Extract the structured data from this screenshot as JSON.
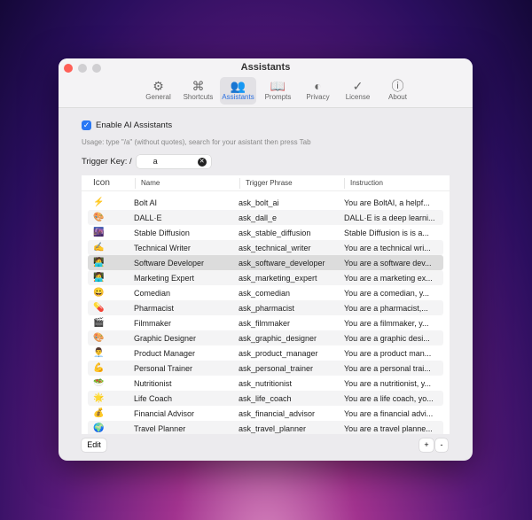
{
  "window": {
    "title": "Assistants"
  },
  "tabs": [
    {
      "label": "General",
      "icon": "⚙"
    },
    {
      "label": "Shortcuts",
      "icon": "⌘"
    },
    {
      "label": "Assistants",
      "icon": "👥"
    },
    {
      "label": "Prompts",
      "icon": "📖"
    },
    {
      "label": "Privacy",
      "icon": "◐"
    },
    {
      "label": "License",
      "icon": "✓"
    },
    {
      "label": "About",
      "icon": "ⓘ"
    }
  ],
  "active_tab": "Assistants",
  "enable_label": "Enable AI Assistants",
  "enable_checked": true,
  "usage": "Usage: type \"/a\" (without quotes), search for your asistant then press Tab",
  "trigger_label": "Trigger Key: /",
  "trigger_value": "a",
  "columns": [
    "Icon",
    "Name",
    "Trigger Phrase",
    "Instruction"
  ],
  "rows": [
    {
      "icon": "⚡",
      "name": "Bolt AI",
      "trigger": "ask_bolt_ai",
      "instruction": "You are BoltAI, a helpf..."
    },
    {
      "icon": "🎨",
      "name": "DALL·E",
      "trigger": "ask_dall_e",
      "instruction": "DALL·E is a deep learni..."
    },
    {
      "icon": "🌆",
      "name": "Stable Diffusion",
      "trigger": "ask_stable_diffusion",
      "instruction": "Stable Diffusion is is a..."
    },
    {
      "icon": "✍️",
      "name": "Technical Writer",
      "trigger": "ask_technical_writer",
      "instruction": "You are a technical wri..."
    },
    {
      "icon": "🧑‍💻",
      "name": "Software Developer",
      "trigger": "ask_software_developer",
      "instruction": "You are a software dev..."
    },
    {
      "icon": "👩‍💻",
      "name": "Marketing Expert",
      "trigger": "ask_marketing_expert",
      "instruction": "You are a marketing ex..."
    },
    {
      "icon": "😀",
      "name": "Comedian",
      "trigger": "ask_comedian",
      "instruction": "You are a comedian, y..."
    },
    {
      "icon": "💊",
      "name": "Pharmacist",
      "trigger": "ask_pharmacist",
      "instruction": "You are a pharmacist,..."
    },
    {
      "icon": "🎬",
      "name": "Filmmaker",
      "trigger": "ask_filmmaker",
      "instruction": "You are a filmmaker, y..."
    },
    {
      "icon": "🎨",
      "name": "Graphic Designer",
      "trigger": "ask_graphic_designer",
      "instruction": "You are a graphic desi..."
    },
    {
      "icon": "👨‍💼",
      "name": "Product Manager",
      "trigger": "ask_product_manager",
      "instruction": "You are a product man..."
    },
    {
      "icon": "💪",
      "name": "Personal Trainer",
      "trigger": "ask_personal_trainer",
      "instruction": "You are a personal trai..."
    },
    {
      "icon": "🥗",
      "name": "Nutritionist",
      "trigger": "ask_nutritionist",
      "instruction": "You are a nutritionist, y..."
    },
    {
      "icon": "🌟",
      "name": "Life Coach",
      "trigger": "ask_life_coach",
      "instruction": "You are a life coach, yo..."
    },
    {
      "icon": "💰",
      "name": "Financial Advisor",
      "trigger": "ask_financial_advisor",
      "instruction": "You are a financial advi..."
    },
    {
      "icon": "🌍",
      "name": "Travel Planner",
      "trigger": "ask_travel_planner",
      "instruction": "You are a travel planne..."
    }
  ],
  "selected_row": 4,
  "buttons": {
    "edit": "Edit",
    "add": "+",
    "remove": "-"
  }
}
